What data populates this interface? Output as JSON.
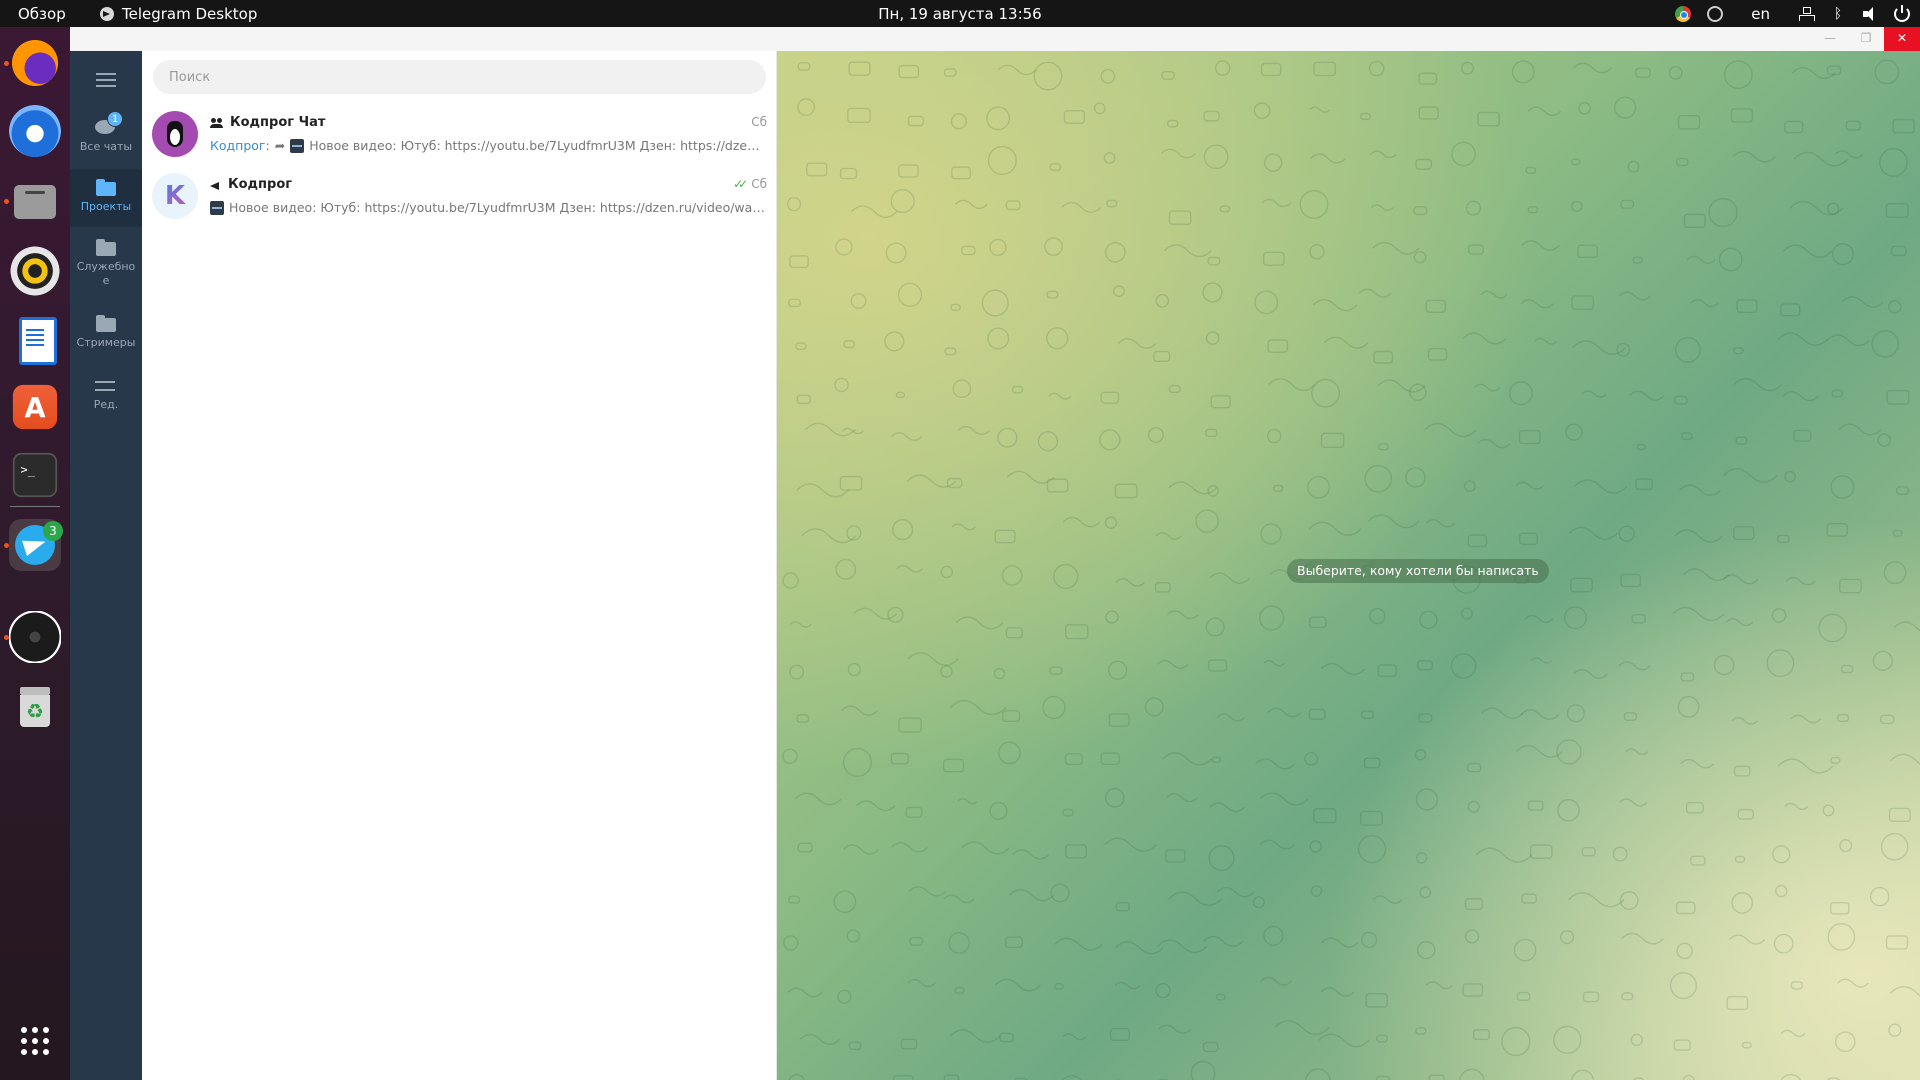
{
  "topbar": {
    "overview": "Обзор",
    "app_name": "Telegram Desktop",
    "clock": "Пн, 19 августа  13:56",
    "lang": "en"
  },
  "window": {
    "search_placeholder": "Поиск",
    "folders": [
      {
        "label": "Все чаты",
        "icon": "chats-icon",
        "badge": "1",
        "active": false
      },
      {
        "label": "Проекты",
        "icon": "folder-icon",
        "active": true
      },
      {
        "label": "Служебное",
        "icon": "folder-icon",
        "active": false
      },
      {
        "label": "Стримеры",
        "icon": "folder-icon",
        "active": false
      },
      {
        "label": "Ред.",
        "icon": "edit-folders-icon",
        "active": false
      }
    ],
    "chats": [
      {
        "title": "Кодпрог Чат",
        "type": "group",
        "date": "Сб",
        "sender": "Кодпрог:",
        "preview": "Новое видео: Ютуб: https://youtu.be/7LyudfmrU3M Дзен: https://dzen.ru..."
      },
      {
        "title": "Кодпрог",
        "type": "channel",
        "date": "Сб",
        "read": true,
        "preview": "Новое видео: Ютуб: https://youtu.be/7LyudfmrU3M Дзен: https://dzen.ru/video/watc..."
      }
    ],
    "empty_chat_hint": "Выберите, кому хотели бы написать"
  },
  "dock": {
    "apps": [
      "firefox",
      "thunderbird",
      "files",
      "rhythmbox",
      "libreoffice-writer",
      "ubuntu-software",
      "terminal",
      "telegram",
      "obs-studio",
      "trash"
    ],
    "telegram_badge": "3",
    "terminal_glyph": ">_",
    "software_glyph": "A"
  },
  "colors": {
    "folder_bar": "#28384b",
    "accent": "#5eb5f7",
    "close_button": "#e81123"
  }
}
